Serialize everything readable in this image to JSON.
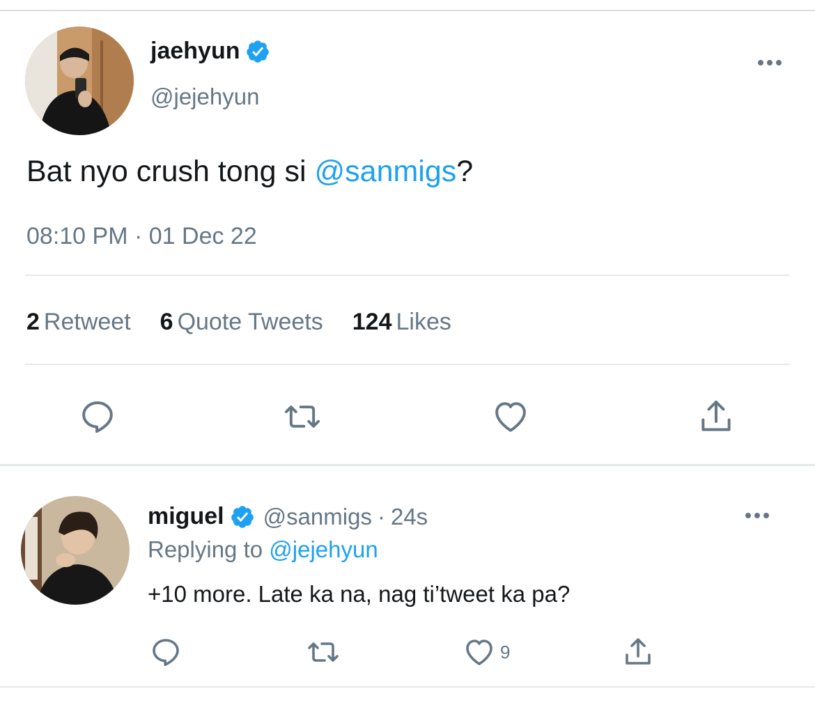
{
  "tweet": {
    "author": {
      "name": "jaehyun",
      "handle": "@jejehyun",
      "verified": true
    },
    "text_prefix": "Bat nyo crush tong si ",
    "mention": "@sanmigs",
    "text_suffix": "?",
    "timestamp": "08:10 PM · 01 Dec 22",
    "stats": {
      "retweets": {
        "count": "2",
        "label": "Retweet"
      },
      "quotes": {
        "count": "6",
        "label": "Quote Tweets"
      },
      "likes": {
        "count": "124",
        "label": "Likes"
      }
    },
    "actions": [
      "reply-icon",
      "retweet-icon",
      "heart-icon",
      "share-icon"
    ]
  },
  "reply": {
    "author": {
      "name": "miguel",
      "handle": "@sanmigs",
      "verified": true
    },
    "separator": "·",
    "time": "24s",
    "replying_prefix": "Replying to ",
    "replying_to": "@jejehyun",
    "text": "+10 more. Late ka na, nag ti’tweet ka pa?",
    "like_count": "9",
    "actions": [
      "reply-icon",
      "retweet-icon",
      "heart-icon",
      "share-icon"
    ]
  },
  "colors": {
    "accent": "#1da1f2",
    "text": "#14171a",
    "secondary": "#657786",
    "divider": "#e6e9ec"
  }
}
